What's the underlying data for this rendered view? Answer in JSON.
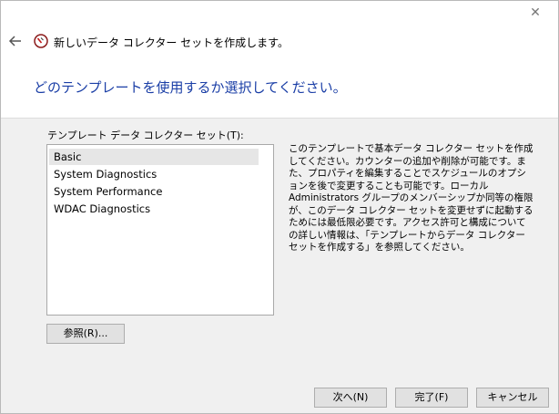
{
  "header": {
    "title": "新しいデータ コレクター セットを作成します。"
  },
  "main": {
    "heading": "どのテンプレートを使用するか選択してください。",
    "list_label": "テンプレート データ コレクター セット(T):",
    "templates": [
      {
        "label": "Basic",
        "selected": true
      },
      {
        "label": "System Diagnostics",
        "selected": false
      },
      {
        "label": "System Performance",
        "selected": false
      },
      {
        "label": "WDAC Diagnostics",
        "selected": false
      }
    ],
    "description": "このテンプレートで基本データ コレクター セットを作成してください。カウンターの追加や削除が可能です。また、プロパティを編集することでスケジュールのオプションを後で変更することも可能です。ローカル Administrators グループのメンバーシップか同等の権限が、このデータ コレクター セットを変更せずに起動するためには最低限必要です。アクセス許可と構成についての詳しい情報は、「テンプレートからデータ コレクター セットを作成する」を参照してください。",
    "browse_label": "参照(R)..."
  },
  "footer": {
    "next_label": "次へ(N)",
    "finish_label": "完了(F)",
    "cancel_label": "キャンセル"
  },
  "colors": {
    "heading": "#1a3ea6",
    "content_bg": "#f0f0f0",
    "selected_item": "#e6e6e6"
  },
  "icons": {
    "back": "back-arrow-icon",
    "wizard": "performance-monitor-icon",
    "close": "close-icon"
  }
}
